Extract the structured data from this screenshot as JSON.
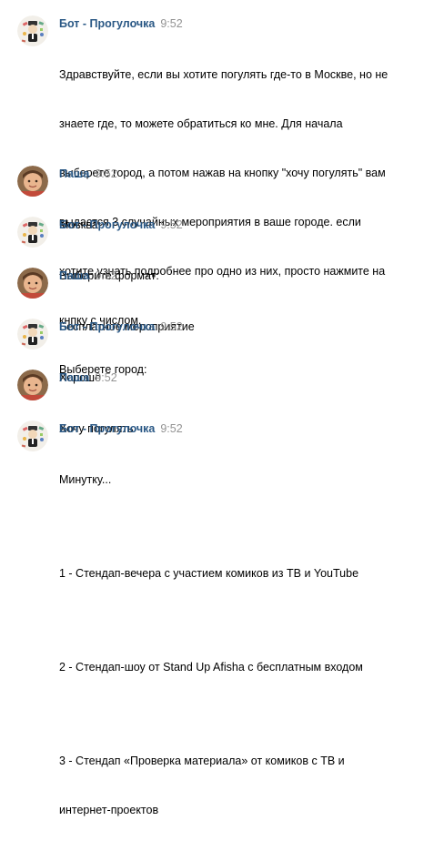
{
  "messages": [
    {
      "author": "Бот - Прогулочка",
      "time": "9:52",
      "lines": [
        "Здравствуйте, если вы хотите погулять где-то в Москве, но не",
        "знаете где, то можете обратиться ко мне. Для начала",
        "выберете город, а потом нажав на кнопку \"хочу погулять\" вам",
        "выдастся 3 случайных мероприятия в ваше городе. если",
        "хотите узнать подробнее про одно из них, просто нажмите на",
        "кнпку с числом.",
        "Выберете город:"
      ]
    },
    {
      "author": "Паша",
      "time": "9:52",
      "lines": [
        "Москва"
      ]
    },
    {
      "author": "Бот - Прогулочка",
      "time": "9:52",
      "lines": [
        "Выберите формат:"
      ]
    },
    {
      "author": "Паша",
      "time": "9:52",
      "lines": [
        "Бесплатное мероприятие"
      ]
    },
    {
      "author": "Бот - Прогулочка",
      "time": "9:52",
      "lines": [
        "Хорошо"
      ]
    },
    {
      "author": "Паша",
      "time": "9:52",
      "lines": [
        "Хочу погулять"
      ]
    },
    {
      "author": "Бот - Прогулочка",
      "time": "9:52",
      "lines": [
        "Минутку..."
      ],
      "items": [
        [
          "1 - Стендап-вечера с участием комиков из ТВ и YouTube"
        ],
        [
          "2 - Стендап-шоу от Stand Up Afisha с бесплатным входом"
        ],
        [
          "3 - Стендап «Проверка материала» от комиков с ТВ и",
          "интернет-проектов"
        ]
      ]
    }
  ],
  "colors": {
    "author": "#2a5885",
    "time": "#939393",
    "text": "#000000",
    "background": "#ffffff"
  },
  "icons": {
    "bot_avatar": "bot-avatar-icon",
    "user_avatar": "user-avatar-photo"
  }
}
